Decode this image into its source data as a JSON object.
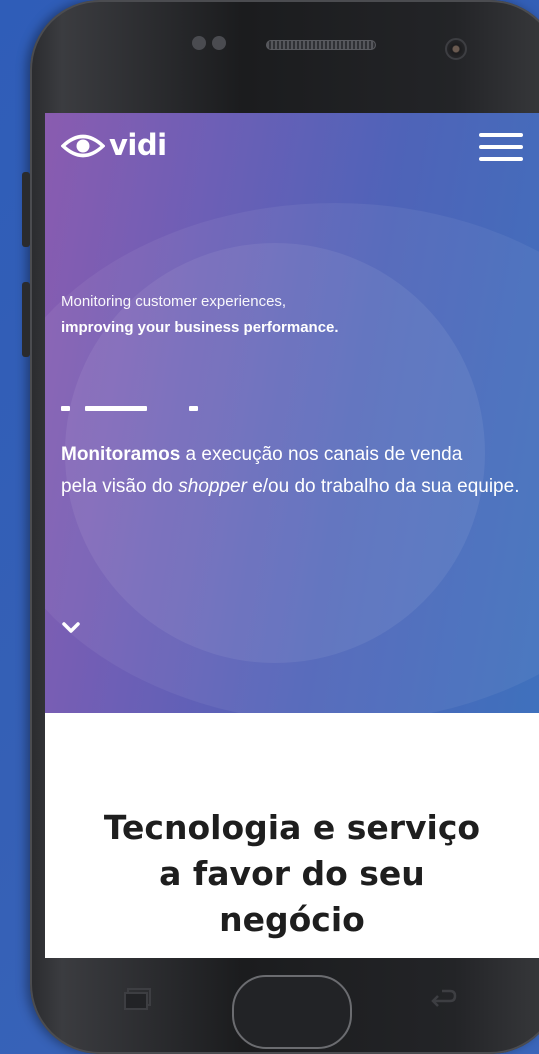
{
  "header": {
    "logo_text": "vidi",
    "logo_icon": "eye-icon",
    "menu_icon": "hamburger-menu-icon"
  },
  "hero": {
    "tagline_line1": "Monitoring customer experiences,",
    "tagline_line2": "improving your business performance.",
    "description_bold": "Monitoramos",
    "description_part1": " a execução nos canais de venda",
    "description_part2": "pela visão do ",
    "description_italic": "shopper",
    "description_part3": " e/ou do trabalho da sua equipe.",
    "scroll_icon": "chevron-down-icon"
  },
  "section": {
    "title_line1": "Tecnologia e serviço",
    "title_line2": "a favor do seu",
    "title_line3": "negócio"
  },
  "device": {
    "home_button": "home-button",
    "recent_icon": "recent-apps-icon",
    "back_icon": "back-icon"
  },
  "colors": {
    "hero_gradient_start": "#8a5cb0",
    "hero_gradient_end": "#3f71bd",
    "page_background": "#3560b6",
    "title_text": "#1e1e1e"
  }
}
